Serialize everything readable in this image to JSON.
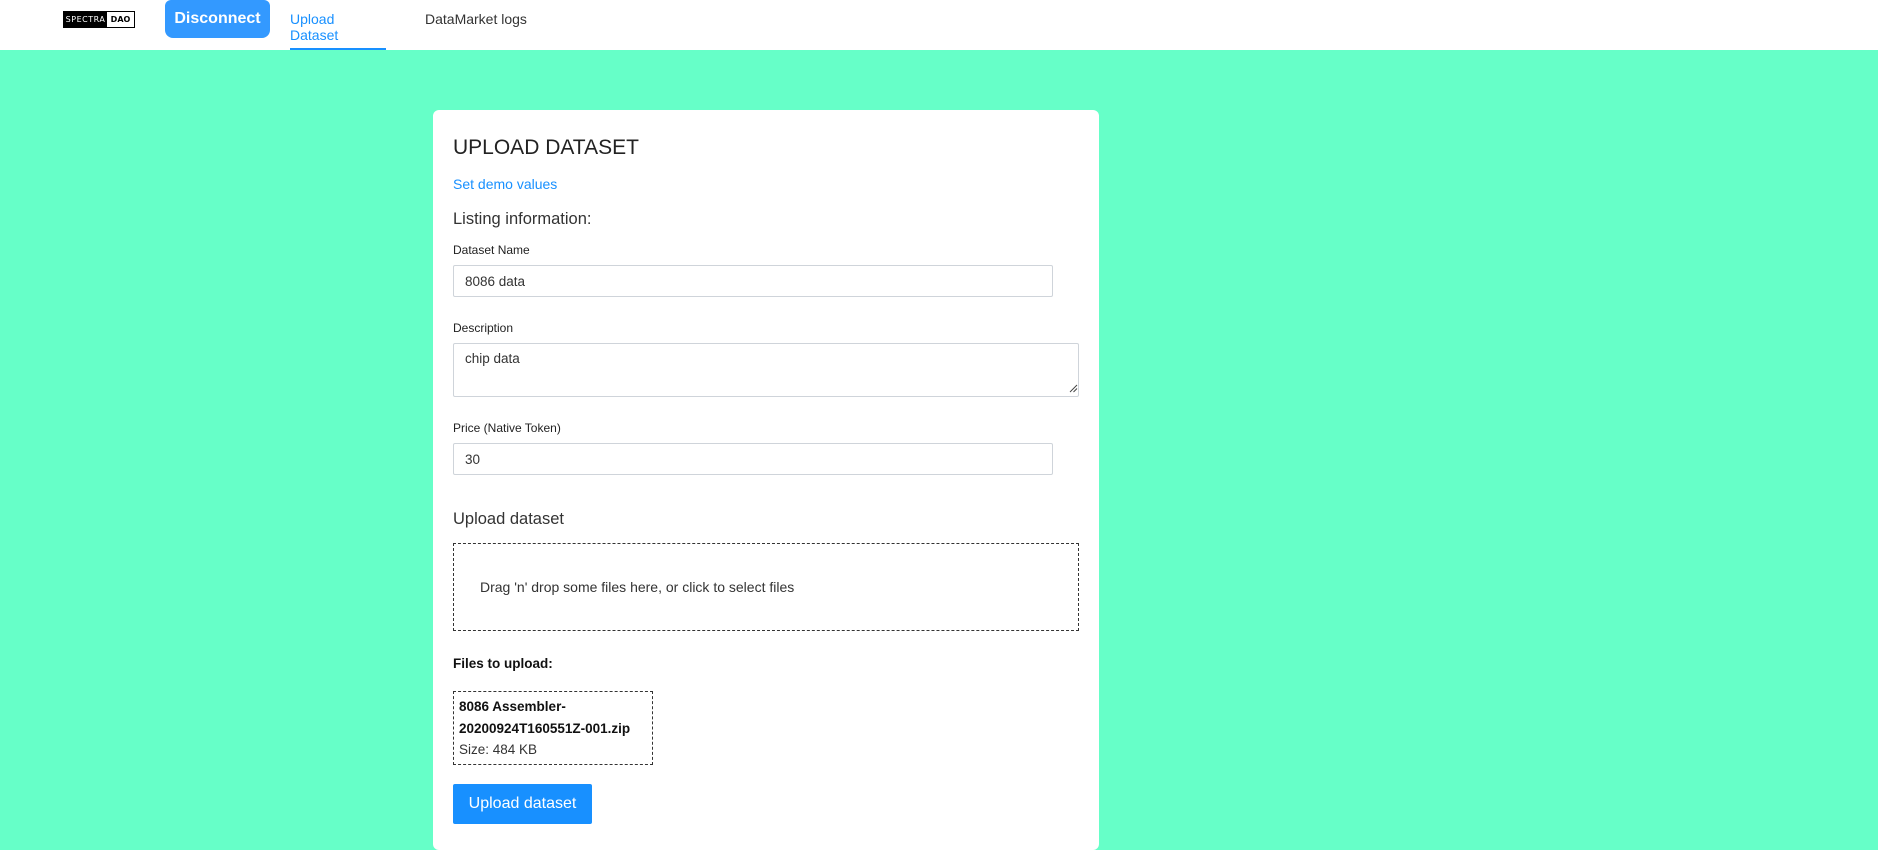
{
  "nav": {
    "logo_left": "SPECTRA",
    "logo_right": "DAO",
    "disconnect_label": "Disconnect",
    "tabs": [
      {
        "label": "Upload Dataset",
        "active": true
      },
      {
        "label": "DataMarket logs",
        "active": false
      }
    ]
  },
  "form": {
    "title": "UPLOAD DATASET",
    "demo_link": "Set demo values",
    "listing_heading": "Listing information:",
    "dataset_name_label": "Dataset Name",
    "dataset_name_value": "8086 data",
    "description_label": "Description",
    "description_value": "chip data",
    "price_label": "Price (Native Token)",
    "price_value": "30",
    "upload_heading": "Upload dataset",
    "dropzone_text": "Drag 'n' drop some files here, or click to select files",
    "files_heading": "Files to upload:",
    "files": [
      {
        "name": "8086 Assembler-20200924T160551Z-001.zip",
        "size": "Size: 484 KB"
      }
    ],
    "submit_label": "Upload dataset"
  },
  "colors": {
    "background": "#66ffc8",
    "accent": "#1890ff",
    "disconnect": "#3399ff"
  }
}
